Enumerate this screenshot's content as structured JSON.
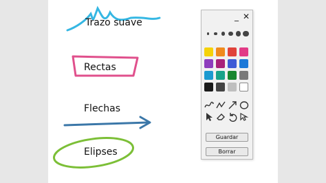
{
  "labels": {
    "smooth": "Trazo suave",
    "lines": "Rectas",
    "arrows": "Flechas",
    "ellipses": "Elipses"
  },
  "palette": {
    "minimize": "_",
    "close": "✕",
    "stroke_sizes": [
      1,
      2,
      3,
      4,
      5,
      6
    ],
    "colors": [
      "#f5d20a",
      "#f08a1d",
      "#e0433b",
      "#e23a86",
      "#8e3dbd",
      "#a8227a",
      "#3f5bd6",
      "#1d79d8",
      "#1c9ad0",
      "#18a38a",
      "#19872f",
      "#7a7a7a",
      "#1a1a1a",
      "#444444",
      "#bfbfbf",
      "#ffffff"
    ],
    "tools": [
      "freehand-icon",
      "polyline-icon",
      "arrow-icon",
      "ellipse-icon",
      "pointer-icon",
      "eraser-icon",
      "undo-icon",
      "select-icon"
    ],
    "save_label": "Guardar",
    "clear_label": "Borrar"
  }
}
